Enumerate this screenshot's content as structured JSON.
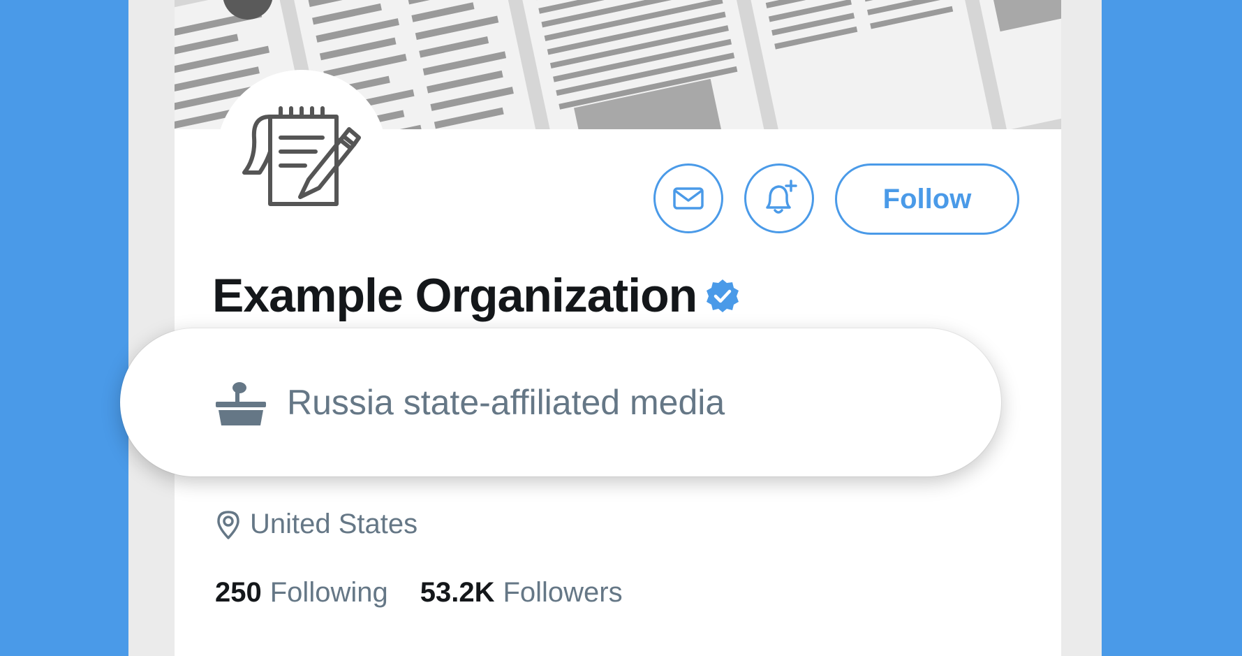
{
  "profile": {
    "display_name": "Example Organization",
    "label": "Russia state-affiliated media",
    "location": "United States",
    "stats": [
      {
        "value": "250",
        "label": "Following"
      },
      {
        "value": "53.2K",
        "label": "Followers"
      }
    ],
    "follow_label": "Follow"
  },
  "icons": {
    "message": "mail-icon",
    "notify": "bell-plus-icon",
    "verified": "verified-badge-icon",
    "state_media": "podium-icon",
    "location": "location-pin-icon",
    "avatar": "notepad-pen-icon"
  },
  "colors": {
    "background": "#4a9ae8",
    "accent": "#4a9ae8",
    "text_primary": "#14171a",
    "text_secondary": "#657786"
  }
}
